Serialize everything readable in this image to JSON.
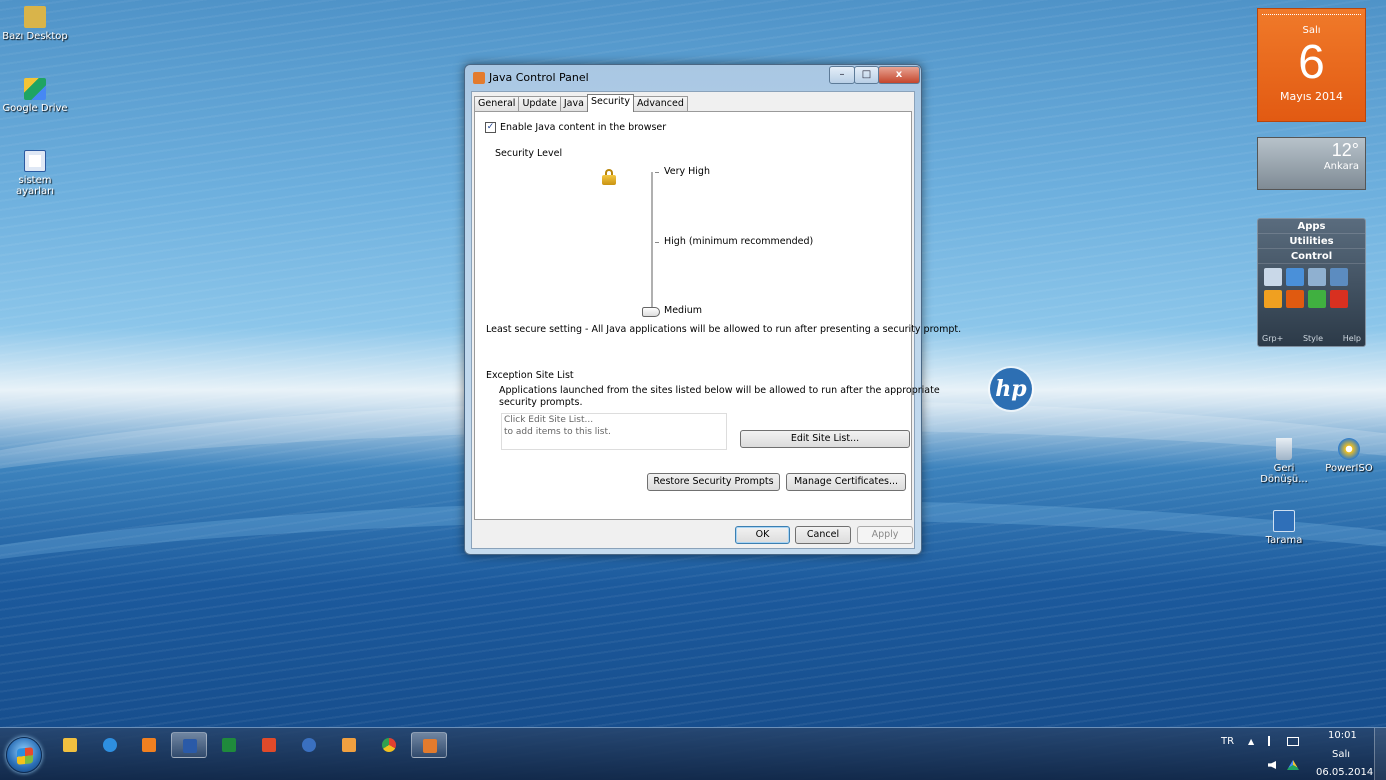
{
  "desktop": {
    "icons_left": [
      {
        "label": "Bazı Desktop",
        "color": "#d9b44a"
      },
      {
        "label": "Google Drive",
        "color": "#f3c437"
      },
      {
        "label_line1": "sistem",
        "label_line2": "ayarları",
        "color": "#2c5aa0"
      }
    ],
    "icons_right": [
      {
        "label_line1": "Geri",
        "label_line2": "Dönüşü...",
        "icon": "recycle-bin-icon"
      },
      {
        "label": "PowerISO",
        "icon": "poweriso-icon"
      },
      {
        "label": "Tarama",
        "icon": "scan-icon"
      }
    ],
    "hp_logo_text": "hp"
  },
  "gadgets": {
    "calendar": {
      "day_name": "Salı",
      "day_num": "6",
      "month": "Mayıs 2014"
    },
    "weather": {
      "temp": "12°",
      "city": "Ankara"
    },
    "apps": {
      "rows": [
        "Apps",
        "Utilities",
        "Control"
      ],
      "footer": [
        "Grp+",
        "Style",
        "Help"
      ],
      "icon_colors": [
        "#c9d8e8",
        "#4a90d9",
        "#8fb0d0",
        "#5c8cc0",
        "#f0a020",
        "#e05a10",
        "#40b040",
        "#d83020"
      ]
    }
  },
  "dialog": {
    "title": "Java Control Panel",
    "min_glyph": "–",
    "max_glyph": "□",
    "close_glyph": "x",
    "tabs": [
      "General",
      "Update",
      "Java",
      "Security",
      "Advanced"
    ],
    "active_tab": "Security",
    "enable_checkbox": {
      "label": "Enable Java content in the browser",
      "checked": true,
      "mark": "✓"
    },
    "security_level_label": "Security Level",
    "levels": [
      "Very High",
      "High (minimum recommended)",
      "Medium"
    ],
    "selected_level": "Medium",
    "level_description": "Least secure setting - All Java applications will be allowed to run after presenting a security prompt.",
    "exception_title": "Exception Site List",
    "exception_desc_line1": "Applications launched from the sites listed below will be allowed to run after the appropriate",
    "exception_desc_line2": "security prompts.",
    "site_list_placeholder_1": "Click Edit Site List...",
    "site_list_placeholder_2": "to add items to this list.",
    "edit_site_list": "Edit Site List...",
    "restore_prompts": "Restore Security Prompts",
    "manage_certs": "Manage Certificates...",
    "ok": "OK",
    "cancel": "Cancel",
    "apply": "Apply"
  },
  "taskbar": {
    "pinned": [
      {
        "name": "explorer",
        "color": "#f0c040"
      },
      {
        "name": "internet-explorer",
        "color": "#2e8fe0"
      },
      {
        "name": "media-player",
        "color": "#f08020"
      },
      {
        "name": "word",
        "color": "#2a5aa8"
      },
      {
        "name": "excel",
        "color": "#1f8a3c"
      },
      {
        "name": "foxit",
        "color": "#e04a2a"
      },
      {
        "name": "google-earth",
        "color": "#3a70c0"
      },
      {
        "name": "bandicam",
        "color": "#f0a040"
      },
      {
        "name": "chrome",
        "color": "#e8b02a"
      },
      {
        "name": "java",
        "color": "#e37b2d"
      }
    ],
    "lang": "TR",
    "tray_arrow": "▲",
    "time": "10:01",
    "day": "Salı",
    "date": "06.05.2014"
  }
}
